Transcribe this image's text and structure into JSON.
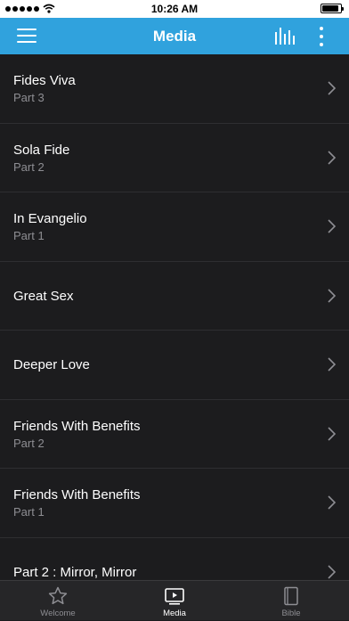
{
  "status": {
    "carrier_signal": "signal",
    "time": "10:26 AM",
    "battery_level": 0.9
  },
  "header": {
    "title": "Media"
  },
  "items": [
    {
      "title": "Fides Viva",
      "subtitle": "Part 3"
    },
    {
      "title": "Sola Fide",
      "subtitle": "Part 2"
    },
    {
      "title": "In Evangelio",
      "subtitle": "Part 1"
    },
    {
      "title": "Great Sex",
      "subtitle": ""
    },
    {
      "title": "Deeper Love",
      "subtitle": ""
    },
    {
      "title": "Friends With Benefits",
      "subtitle": "Part 2"
    },
    {
      "title": "Friends With Benefits",
      "subtitle": "Part 1"
    },
    {
      "title": "Part 2 : Mirror, Mirror",
      "subtitle": ""
    }
  ],
  "tabs": [
    {
      "label": "Welcome",
      "icon": "star-icon"
    },
    {
      "label": "Media",
      "icon": "media-icon"
    },
    {
      "label": "Bible",
      "icon": "book-icon"
    }
  ],
  "colors": {
    "accent": "#30a2dd",
    "background": "#1c1c1e",
    "tabbar": "#262628"
  }
}
